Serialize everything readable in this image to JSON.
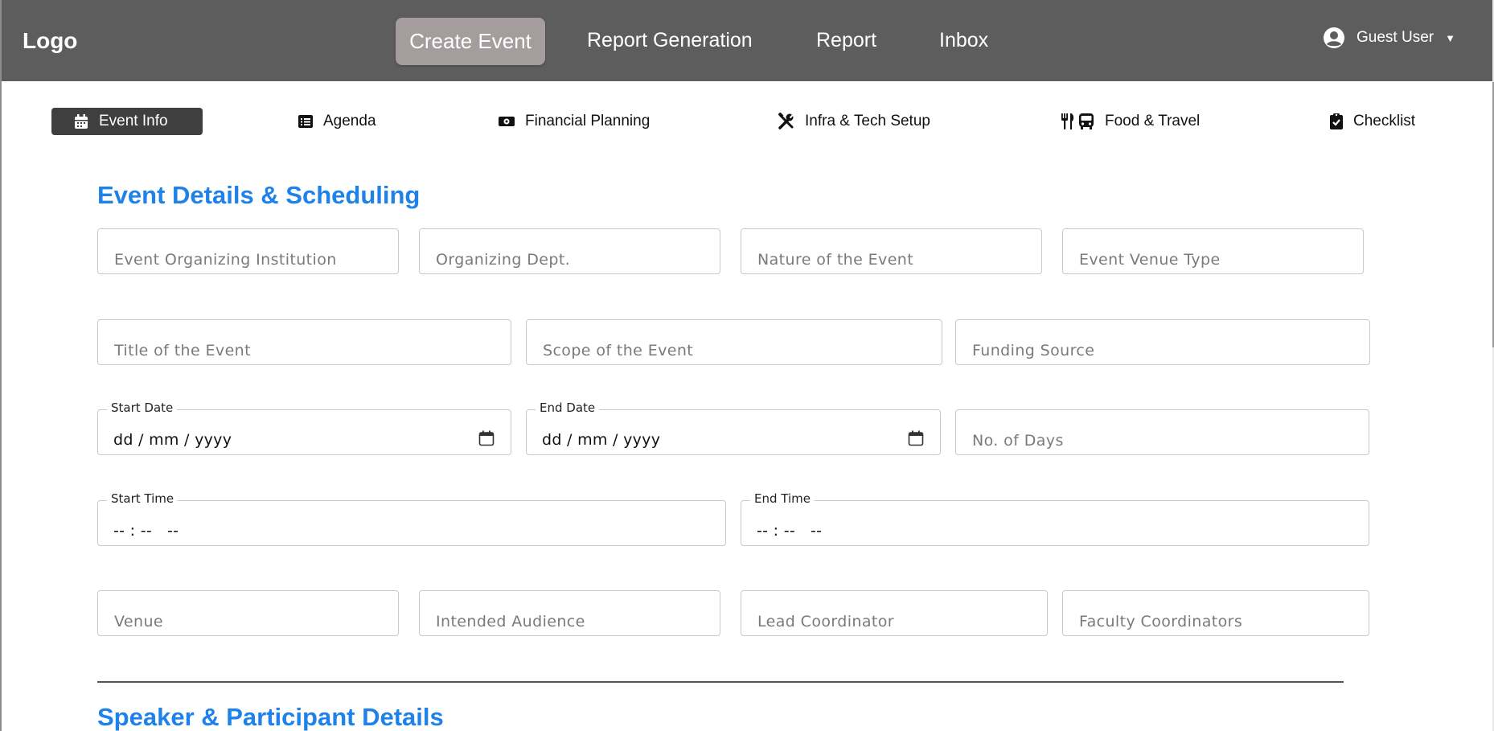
{
  "navbar": {
    "logo": "Logo",
    "links": [
      "Create Event",
      "Report Generation",
      "Report",
      "Inbox"
    ],
    "user": "Guest User",
    "caret": "▼"
  },
  "tabs": [
    {
      "label": "Event Info",
      "icon": "calendar-icon"
    },
    {
      "label": "Agenda",
      "icon": "list-icon"
    },
    {
      "label": "Financial Planning",
      "icon": "money-bill-icon"
    },
    {
      "label": "Infra & Tech Setup",
      "icon": "tools-icon"
    },
    {
      "label": "Food & Travel",
      "icon": "utensils-bus-icon"
    },
    {
      "label": "Checklist",
      "icon": "clipboard-check-icon"
    }
  ],
  "sections": {
    "event_details": "Event Details & Scheduling",
    "speaker": "Speaker & Participant Details"
  },
  "fields": {
    "institution": "Event Organizing Institution",
    "dept": "Organizing Dept.",
    "nature": "Nature of the Event",
    "venue_type": "Event Venue Type",
    "title": "Title of the Event",
    "scope": "Scope of the Event",
    "funding": "Funding Source",
    "start_date_label": "Start Date",
    "start_date_value": "dd / mm / yyyy",
    "end_date_label": "End Date",
    "end_date_value": "dd / mm / yyyy",
    "days": "No. of Days",
    "start_time_label": "Start Time",
    "start_time_value": "-- : --   --",
    "end_time_label": "End Time",
    "end_time_value": "-- : --   --",
    "venue": "Venue",
    "audience": "Intended Audience",
    "lead": "Lead Coordinator",
    "faculty": "Faculty Coordinators"
  },
  "colors": {
    "navbar": "#5d5d5d",
    "nav_active": "#a59d9d",
    "tab_active": "#3f3f3f",
    "section_title": "#1e82ea"
  }
}
